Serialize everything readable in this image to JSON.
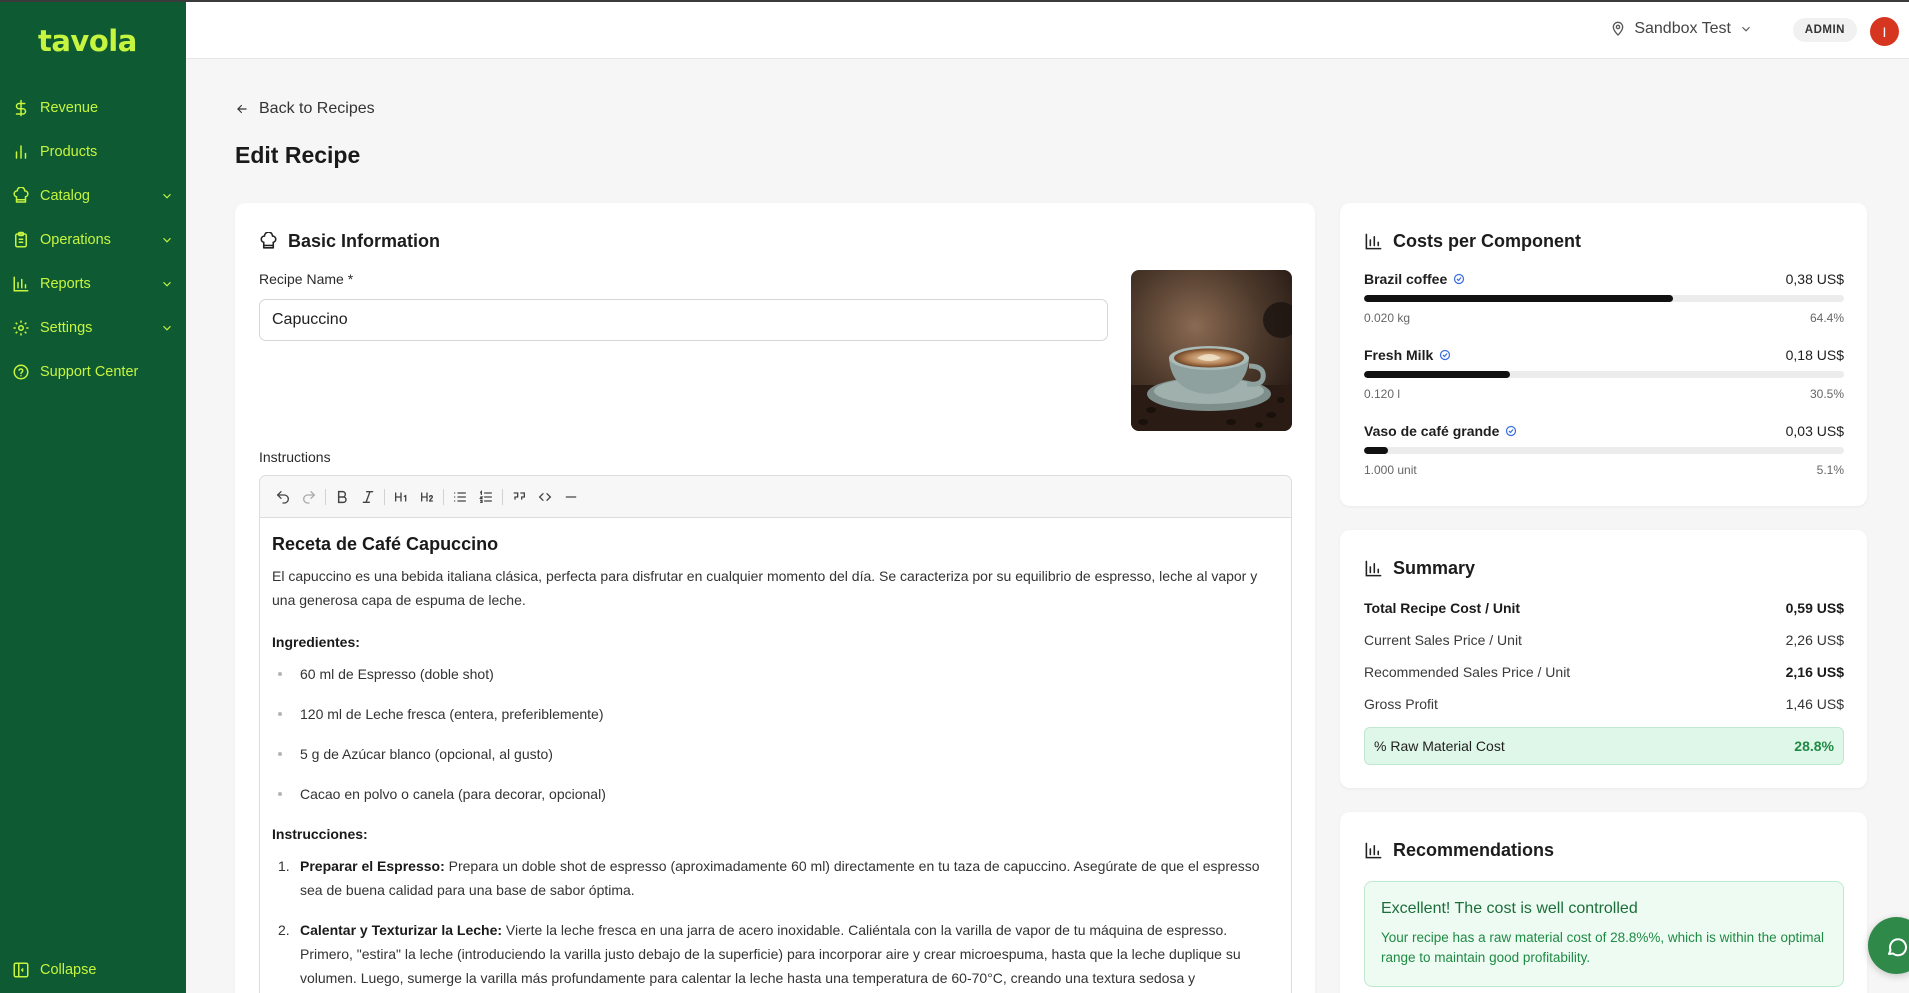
{
  "brand": {
    "logo": "tavola",
    "accent": "#c6f53f",
    "sidebar_bg": "#0d5a33"
  },
  "sidebar": {
    "items": [
      {
        "label": "Revenue",
        "icon": "dollar-icon",
        "has_chevron": false
      },
      {
        "label": "Products",
        "icon": "bar-chart-icon",
        "has_chevron": false
      },
      {
        "label": "Catalog",
        "icon": "chef-hat-icon",
        "has_chevron": true
      },
      {
        "label": "Operations",
        "icon": "clipboard-icon",
        "has_chevron": true
      },
      {
        "label": "Reports",
        "icon": "chart-icon",
        "has_chevron": true
      },
      {
        "label": "Settings",
        "icon": "gear-icon",
        "has_chevron": true
      },
      {
        "label": "Support Center",
        "icon": "help-circle-icon",
        "has_chevron": false
      }
    ],
    "collapse_label": "Collapse"
  },
  "topbar": {
    "location": "Sandbox Test",
    "role_badge": "ADMIN",
    "avatar_initial": "I"
  },
  "page": {
    "back_label": "Back to Recipes",
    "title": "Edit Recipe"
  },
  "basic_info": {
    "title": "Basic Information",
    "name_label": "Recipe Name *",
    "name_value": "Capuccino",
    "instructions_label": "Instructions"
  },
  "editor": {
    "heading": "Receta de Café Capuccino",
    "intro": "El capuccino es una bebida italiana clásica, perfecta para disfrutar en cualquier momento del día. Se caracteriza por su equilibrio de espresso, leche al vapor y una generosa capa de espuma de leche.",
    "ingredients_title": "Ingredientes:",
    "ingredients": [
      "60 ml de Espresso (doble shot)",
      "120 ml de Leche fresca (entera, preferiblemente)",
      "5 g de Azúcar blanco (opcional, al gusto)",
      "Cacao en polvo o canela (para decorar, opcional)"
    ],
    "steps_title": "Instrucciones:",
    "steps": [
      {
        "num": "1.",
        "title": "Preparar el Espresso:",
        "text": " Prepara un doble shot de espresso (aproximadamente 60 ml) directamente en tu taza de capuccino. Asegúrate de que el espresso sea de buena calidad para una base de sabor óptima."
      },
      {
        "num": "2.",
        "title": "Calentar y Texturizar la Leche:",
        "text": " Vierte la leche fresca en una jarra de acero inoxidable. Caliéntala con la varilla de vapor de tu máquina de espresso. Primero, \"estira\" la leche (introduciendo la varilla justo debajo de la superficie) para incorporar aire y crear microespuma, hasta que la leche duplique su volumen. Luego, sumerge la varilla más profundamente para calentar la leche hasta una temperatura de 60-70°C, creando una textura sedosa y"
      }
    ]
  },
  "costs": {
    "title": "Costs per Component",
    "components": [
      {
        "name": "Brazil coffee",
        "cost": "0,38 US$",
        "qty": "0.020 kg",
        "pct": "64.4%",
        "fraction": 0.644
      },
      {
        "name": "Fresh Milk",
        "cost": "0,18 US$",
        "qty": "0.120 l",
        "pct": "30.5%",
        "fraction": 0.305
      },
      {
        "name": "Vaso de café grande",
        "cost": "0,03 US$",
        "qty": "1.000 unit",
        "pct": "5.1%",
        "fraction": 0.051
      }
    ]
  },
  "summary": {
    "title": "Summary",
    "rows": [
      {
        "label": "Total Recipe Cost / Unit",
        "value": "0,59 US$"
      },
      {
        "label": "Current Sales Price / Unit",
        "value": "2,26 US$"
      },
      {
        "label": "Recommended Sales Price / Unit",
        "value": "2,16 US$"
      },
      {
        "label": "Gross Profit",
        "value": "1,46 US$"
      }
    ],
    "raw_label": "% Raw Material Cost",
    "raw_value": "28.8%"
  },
  "recommendations": {
    "title": "Recommendations",
    "box_title": "Excellent! The cost is well controlled",
    "box_text": "Your recipe has a raw material cost of 28.8%%, which is within the optimal range to maintain good profitability."
  }
}
